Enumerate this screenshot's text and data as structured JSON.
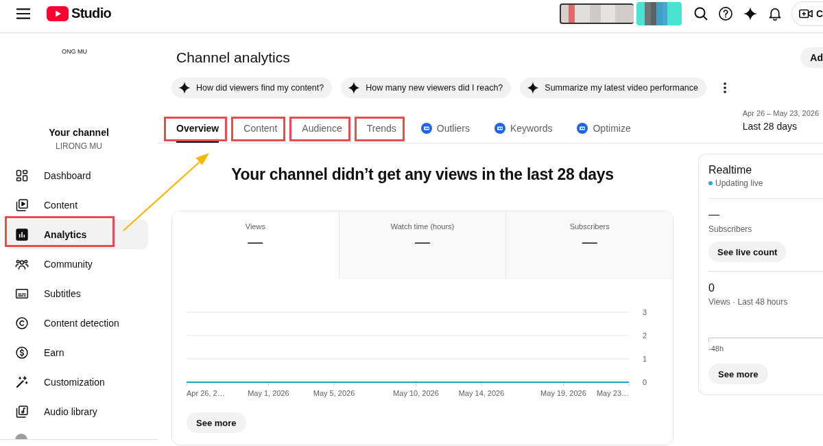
{
  "top_bar": {
    "logo_text": "Studio",
    "create_label": "C"
  },
  "sidebar": {
    "cut_label": "ONG MU",
    "channel_title": "Your channel",
    "channel_name": "LIRONG MU",
    "items": [
      {
        "label": "Dashboard",
        "selected": false,
        "highlighted": false
      },
      {
        "label": "Content",
        "selected": false,
        "highlighted": false
      },
      {
        "label": "Analytics",
        "selected": true,
        "highlighted": true
      },
      {
        "label": "Community",
        "selected": false,
        "highlighted": false
      },
      {
        "label": "Subtitles",
        "selected": false,
        "highlighted": false
      },
      {
        "label": "Content detection",
        "selected": false,
        "highlighted": false
      },
      {
        "label": "Earn",
        "selected": false,
        "highlighted": false
      },
      {
        "label": "Customization",
        "selected": false,
        "highlighted": false
      },
      {
        "label": "Audio library",
        "selected": false,
        "highlighted": false
      }
    ]
  },
  "header": {
    "title": "Channel analytics",
    "mode_button": "Ad",
    "suggestions": [
      {
        "label": "How did viewers find my content?"
      },
      {
        "label": "How many new viewers did I reach?"
      },
      {
        "label": "Summarize my latest video performance"
      }
    ],
    "tabs": [
      {
        "label": "Overview",
        "kind": "plain",
        "selected": true,
        "highlighted": true
      },
      {
        "label": "Content",
        "kind": "plain",
        "selected": false,
        "highlighted": true
      },
      {
        "label": "Audience",
        "kind": "plain",
        "selected": false,
        "highlighted": true
      },
      {
        "label": "Trends",
        "kind": "plain",
        "selected": false,
        "highlighted": true
      },
      {
        "label": "Outliers",
        "kind": "tool",
        "selected": false,
        "highlighted": false
      },
      {
        "label": "Keywords",
        "kind": "tool",
        "selected": false,
        "highlighted": false
      },
      {
        "label": "Optimize",
        "kind": "tool",
        "selected": false,
        "highlighted": false
      }
    ],
    "date_range": "Apr 26 – May 23, 2026",
    "period": "Last 28 days"
  },
  "overview": {
    "headline": "Your channel didn’t get any views in the last 28 days",
    "metrics": [
      {
        "label": "Views",
        "value": "—",
        "selected": true
      },
      {
        "label": "Watch time (hours)",
        "value": "—",
        "selected": false
      },
      {
        "label": "Subscribers",
        "value": "—",
        "selected": false
      }
    ],
    "range_start": "Apr 26, 2…",
    "range_end": "May 23…",
    "chart_data": {
      "type": "line",
      "categories": [
        null,
        null,
        null,
        null,
        null,
        "May 1, 2026",
        null,
        null,
        null,
        "May 5, 2026",
        null,
        null,
        null,
        null,
        "May 10, 2026",
        null,
        null,
        null,
        "May 14, 2026",
        null,
        null,
        null,
        null,
        "May 19, 2026",
        null,
        null,
        null,
        null
      ],
      "ylim": [
        0,
        3
      ],
      "yticks": [
        0,
        1,
        2,
        3
      ],
      "series": [
        {
          "color": "#1ea1c8",
          "values": [
            0,
            0,
            0,
            0,
            0,
            0,
            0,
            0,
            0,
            0,
            0,
            0,
            0,
            0,
            0,
            0,
            0,
            0,
            0,
            0,
            0,
            0,
            0,
            0,
            0,
            0,
            0,
            0
          ]
        }
      ]
    },
    "see_more": "See more"
  },
  "realtime": {
    "title": "Realtime",
    "status": "Updating live",
    "subscribers_value": "—",
    "subscribers_label": "Subscribers",
    "live_button": "See live count",
    "views_value": "0",
    "views_label": "Views · Last 48 hours",
    "axis_label": "-48h",
    "see_more": "See more"
  }
}
